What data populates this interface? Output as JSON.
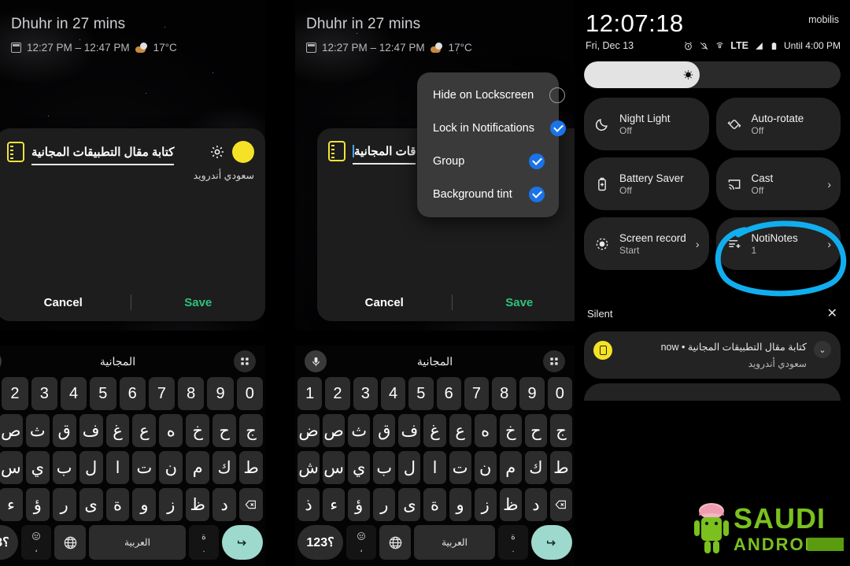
{
  "lockscreen": {
    "prayer_text": "Dhuhr in 27 mins",
    "event_time": "12:27 PM – 12:47 PM",
    "temperature": "17°C",
    "calendar_icon": "calendar-icon",
    "weather_icon": "cloud-sun-icon"
  },
  "note_dialog": {
    "note_icon": "notepad-icon",
    "input_value": "كتابة مقال التطبيقات المجانية",
    "input_value_partial": "قات المجانية",
    "gear_icon": "gear-icon",
    "color_swatch": "#f5e227",
    "app_name": "سعودي أندرويد",
    "cancel_label": "Cancel",
    "save_label": "Save",
    "save_color": "#2ec27e"
  },
  "popup_menu": {
    "items": [
      {
        "label": "Hide on Lockscreen",
        "checked": false
      },
      {
        "label": "Lock in Notifications",
        "checked": true
      },
      {
        "label": "Group",
        "checked": true
      },
      {
        "label": "Background tint",
        "checked": true
      }
    ],
    "check_color": "#1a73e8"
  },
  "keyboard": {
    "suggestion": "المجانية",
    "mic_icon": "microphone-icon",
    "grid_icon": "grid-menu-icon",
    "row_numbers": [
      "1",
      "2",
      "3",
      "4",
      "5",
      "6",
      "7",
      "8",
      "9",
      "0"
    ],
    "row_1": [
      "ض",
      "ص",
      "ث",
      "ق",
      "ف",
      "غ",
      "ع",
      "ه",
      "خ",
      "ح",
      "ج"
    ],
    "row_2": [
      "ش",
      "س",
      "ي",
      "ب",
      "ل",
      "ا",
      "ت",
      "ن",
      "م",
      "ك",
      "ط"
    ],
    "row_3": [
      "ذ",
      "ء",
      "ؤ",
      "ر",
      "ى",
      "ة",
      "و",
      "ز",
      "ظ",
      "د"
    ],
    "backspace_icon": "backspace-icon",
    "symbols_key": "؟123",
    "emoji_key_top": "emoji-icon",
    "emoji_key_bottom": "،",
    "globe_icon": "globe-icon",
    "space_label": "العربية",
    "period_key_top": "ة",
    "period_key_bottom": ".",
    "enter_icon": "enter-arrow-icon",
    "enter_color": "#9ed9ce"
  },
  "quick_settings": {
    "clock": "12:07:18",
    "date": "Fri, Dec 13",
    "carrier": "mobilis",
    "status_icons": [
      "alarm-icon",
      "mute-bell-icon",
      "cast-wifi-icon"
    ],
    "network": "LTE",
    "signal_icon": "signal-bars-icon",
    "battery_icon": "battery-icon",
    "battery_text": "Until 4:00 PM",
    "brightness_icon": "brightness-icon",
    "brightness_percent": 45,
    "tiles": [
      {
        "label": "Night Light",
        "state": "Off",
        "icon": "moon-icon",
        "chevron": false
      },
      {
        "label": "Auto-rotate",
        "state": "Off",
        "icon": "rotate-icon",
        "chevron": false
      },
      {
        "label": "Battery Saver",
        "state": "Off",
        "icon": "battery-saver-icon",
        "chevron": false
      },
      {
        "label": "Cast",
        "state": "Off",
        "icon": "cast-icon",
        "chevron": true
      },
      {
        "label": "Screen record",
        "state": "Start",
        "icon": "record-icon",
        "chevron": true
      },
      {
        "label": "NotiNotes",
        "state": "1",
        "icon": "notinotes-icon",
        "chevron": true
      }
    ],
    "highlight_color": "#00AEEF",
    "highlighted_tile": "NotiNotes"
  },
  "notifications": {
    "section_label": "Silent",
    "close_icon": "close-icon",
    "items": [
      {
        "title": "كتابة مقال التطبيقات المجانية • now",
        "subtitle": "سعودي أندرويد",
        "badge_color": "#f5e227",
        "expand_icon": "chevron-down-icon"
      }
    ]
  },
  "watermark": {
    "line1": "SAUDI",
    "line2": "ANDROID",
    "mascot": "android-mascot-icon",
    "color_green": "#7ac11f",
    "color_dark_green": "#5a9b10"
  }
}
